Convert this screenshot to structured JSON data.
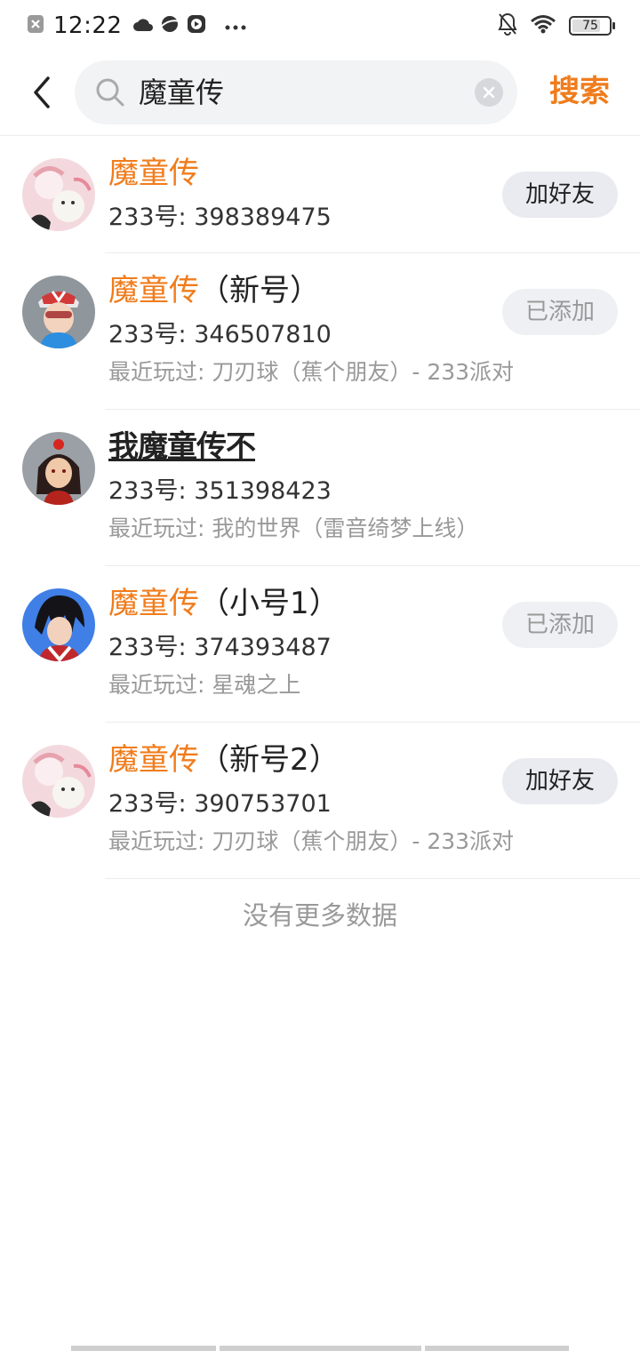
{
  "status_bar": {
    "time": "12:22",
    "battery": "75",
    "icons": [
      "close-square-icon",
      "cloud-icon",
      "planet-icon",
      "play-circle-icon",
      "more-dots-icon",
      "bell-off-icon",
      "wifi-icon",
      "battery-icon"
    ]
  },
  "header": {
    "query": "魔童传",
    "search_label": "搜索"
  },
  "colors": {
    "accent": "#f07c1c",
    "secondary_text": "#999999",
    "button_bg": "#e9ebf0"
  },
  "results": [
    {
      "name_highlight": "魔童传",
      "name_suffix": "",
      "id_text": "233号: 398389475",
      "played": "",
      "action": "加好友",
      "added": false
    },
    {
      "name_highlight": "魔童传",
      "name_suffix": "（新号）",
      "id_text": "233号: 346507810",
      "played": "最近玩过: 刀刃球（蕉个朋友）- 233派对",
      "action": "已添加",
      "added": true
    },
    {
      "name_highlight": "",
      "name_suffix": "我魔童传不",
      "id_text": "233号: 351398423",
      "played": "最近玩过: 我的世界（雷音绮梦上线）",
      "action": "",
      "added": false
    },
    {
      "name_highlight": "魔童传",
      "name_suffix": "（小号1）",
      "id_text": "233号: 374393487",
      "played": "最近玩过: 星魂之上",
      "action": "已添加",
      "added": true
    },
    {
      "name_highlight": "魔童传",
      "name_suffix": "（新号2）",
      "id_text": "233号: 390753701",
      "played": "最近玩过: 刀刃球（蕉个朋友）- 233派对",
      "action": "加好友",
      "added": false
    }
  ],
  "footer": {
    "no_more": "没有更多数据"
  }
}
